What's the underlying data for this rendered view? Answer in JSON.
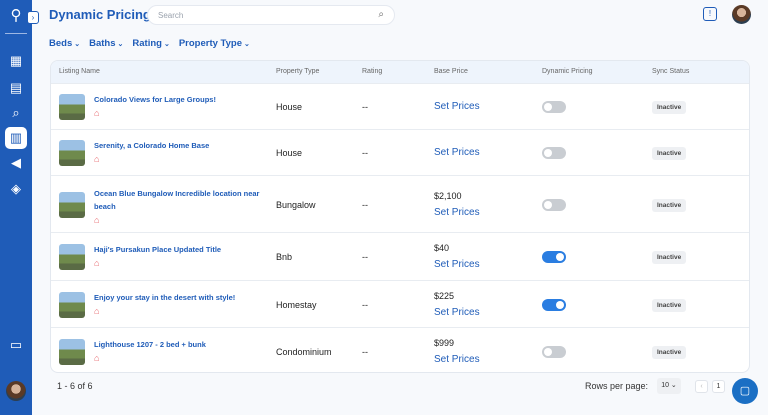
{
  "header": {
    "title": "Dynamic Pricing",
    "search_placeholder": "Search"
  },
  "filters": [
    {
      "label": "Beds"
    },
    {
      "label": "Baths"
    },
    {
      "label": "Rating"
    },
    {
      "label": "Property Type"
    }
  ],
  "table": {
    "columns": [
      "Listing Name",
      "Property Type",
      "Rating",
      "Base Price",
      "Dynamic Pricing",
      "Sync Status"
    ],
    "rows": [
      {
        "name": "Colorado Views for Large Groups!",
        "type": "House",
        "rating": "--",
        "price": "",
        "action": "Set Prices",
        "dynamic": false,
        "status": "Inactive"
      },
      {
        "name": "Serenity, a Colorado Home Base",
        "type": "House",
        "rating": "--",
        "price": "",
        "action": "Set Prices",
        "dynamic": false,
        "status": "Inactive"
      },
      {
        "name": "Ocean Blue Bungalow Incredible location near beach",
        "type": "Bungalow",
        "rating": "--",
        "price": "$2,100",
        "action": "Set Prices",
        "dynamic": false,
        "status": "Inactive"
      },
      {
        "name": "Haji's Pursakun Place Updated Title",
        "type": "Bnb",
        "rating": "--",
        "price": "$40",
        "action": "Set Prices",
        "dynamic": true,
        "status": "Inactive"
      },
      {
        "name": "Enjoy your stay in the desert with style!",
        "type": "Homestay",
        "rating": "--",
        "price": "$225",
        "action": "Set Prices",
        "dynamic": true,
        "status": "Inactive"
      },
      {
        "name": "Lighthouse 1207 - 2 bed + bunk",
        "type": "Condominium",
        "rating": "--",
        "price": "$999",
        "action": "Set Prices",
        "dynamic": false,
        "status": "Inactive"
      }
    ]
  },
  "footer": {
    "range": "1 - 6 of 6",
    "rows_label": "Rows per page:",
    "rows_value": "10",
    "page": "1"
  },
  "colors": {
    "primary": "#1f5cb8",
    "toggle_on": "#2a7de1"
  }
}
